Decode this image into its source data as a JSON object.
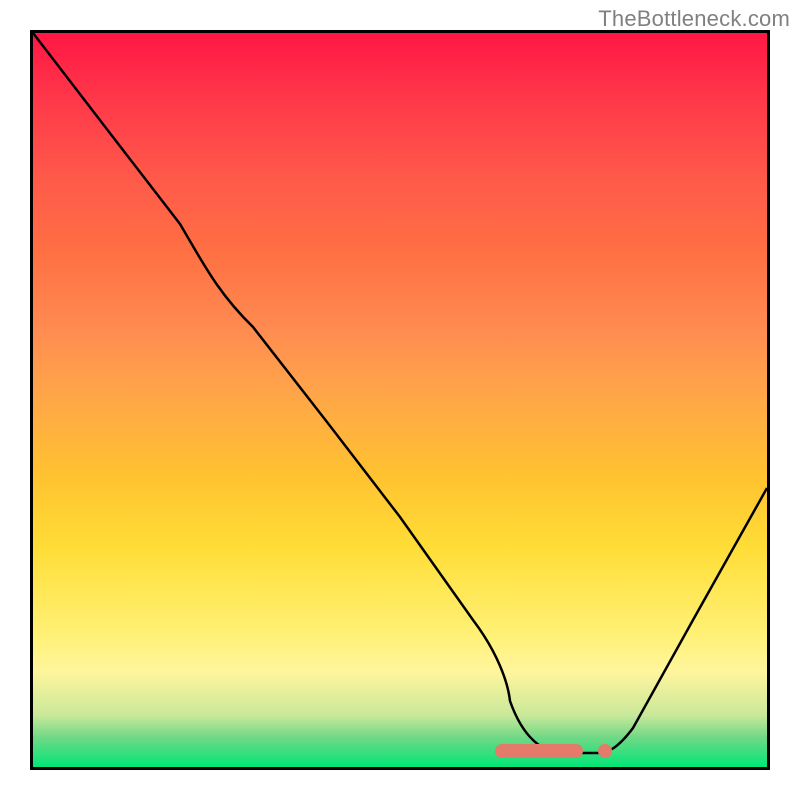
{
  "watermark": "TheBottleneck.com",
  "chart_data": {
    "type": "line",
    "title": "",
    "xlabel": "",
    "ylabel": "",
    "xlim": [
      0,
      100
    ],
    "ylim": [
      0,
      100
    ],
    "grid": false,
    "legend": false,
    "gradient_stops": [
      {
        "pos": 0,
        "color": "#ff1744"
      },
      {
        "pos": 50,
        "color": "#ffc130"
      },
      {
        "pos": 85,
        "color": "#fff176"
      },
      {
        "pos": 100,
        "color": "#00e676"
      }
    ],
    "series": [
      {
        "name": "bottleneck-curve",
        "x": [
          0,
          10,
          20,
          25,
          30,
          40,
          50,
          60,
          65,
          70,
          75,
          80,
          90,
          100
        ],
        "y": [
          100,
          87,
          74,
          67,
          60,
          47,
          34,
          20,
          12,
          4,
          2,
          4,
          20,
          38
        ]
      }
    ],
    "optimal_marker": {
      "x_start": 63,
      "x_end": 77,
      "y": 2,
      "color": "#e47a6a"
    }
  }
}
